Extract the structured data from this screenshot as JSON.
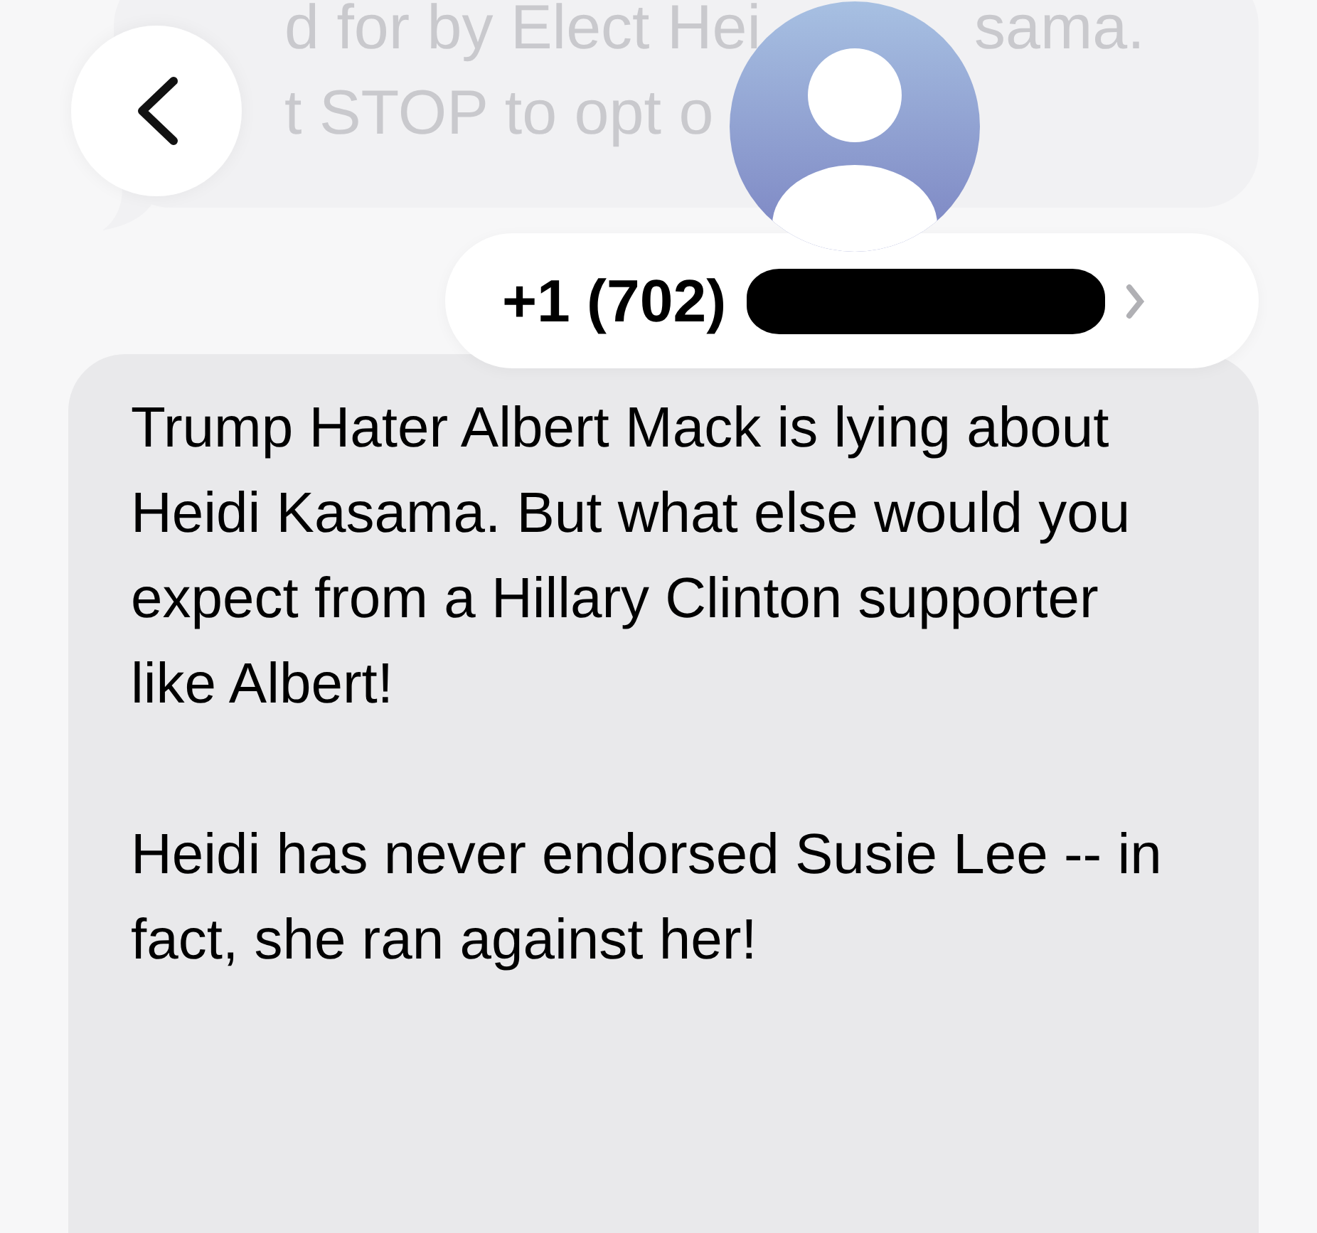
{
  "previous_message": {
    "lines": [
      [
        "d for by Elect Hei",
        "sama."
      ],
      [
        "t STOP to opt o"
      ]
    ]
  },
  "contact": {
    "name": "+1 (702)",
    "redacted": true
  },
  "message": {
    "paragraphs": [
      "Trump Hater Albert Mack is lying about Heidi Kasama. But what else would you expect from a Hillary Clinton supporter like Albert!",
      "Heidi has never endorsed Susie Lee -- in fact, she ran against her!"
    ]
  }
}
